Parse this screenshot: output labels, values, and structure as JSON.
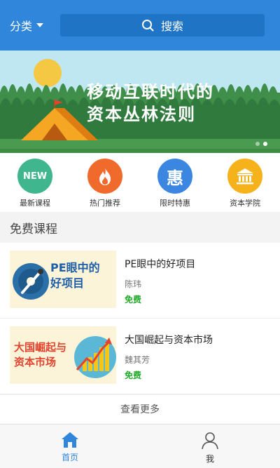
{
  "header": {
    "category_label": "分类",
    "search_label": "搜索"
  },
  "banner": {
    "line1": "移动互联时代的",
    "line2": "资本丛林法则",
    "slides_total": 2,
    "active_slide": 2
  },
  "quick_nav": [
    {
      "label": "最新课程",
      "icon": "new-badge-icon",
      "icon_text": "NEW",
      "color": "#3fb68e"
    },
    {
      "label": "热门推荐",
      "icon": "flame-icon",
      "color": "#f06a2c"
    },
    {
      "label": "限时特惠",
      "icon": "discount-icon",
      "icon_text": "惠",
      "color": "#3a86e0"
    },
    {
      "label": "资本学院",
      "icon": "academy-building-icon",
      "color": "#f5b21b"
    }
  ],
  "section": {
    "title": "免费课程"
  },
  "courses": [
    {
      "title": "PE眼中的好项目",
      "author": "陈玮",
      "price": "免费",
      "thumb_text_line1": "PE眼中的",
      "thumb_text_line2": "好项目"
    },
    {
      "title": "大国崛起与资本市场",
      "author": "魏其芳",
      "price": "免费",
      "thumb_text_line1": "大国崛起与",
      "thumb_text_line2": "资本市场"
    }
  ],
  "more_label": "查看更多",
  "tabbar": {
    "home_label": "首页",
    "me_label": "我"
  },
  "colors": {
    "primary": "#2f86da",
    "free_green": "#22aa2a"
  }
}
